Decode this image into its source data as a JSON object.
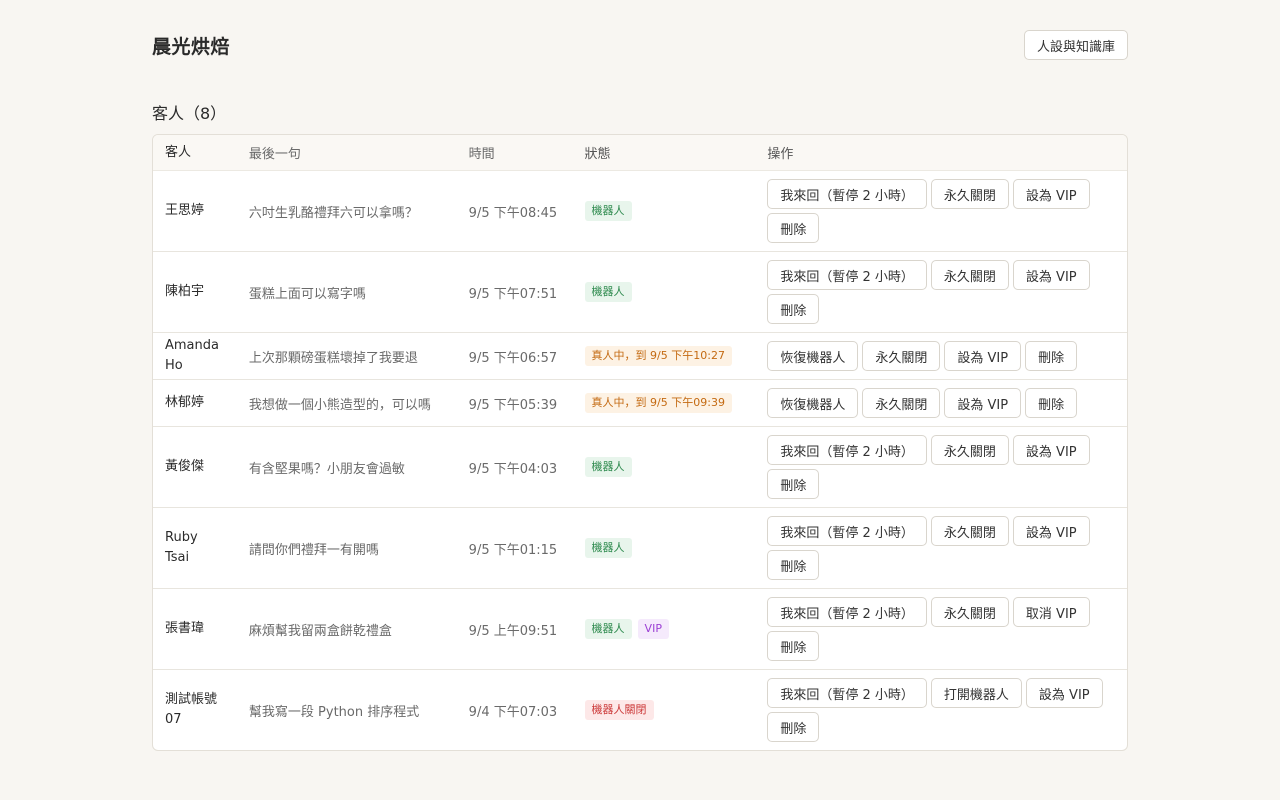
{
  "header": {
    "brand": "晨光烘焙",
    "kb_button": "人設與知識庫"
  },
  "section": {
    "title": "客人（8）"
  },
  "table": {
    "columns": [
      "客人",
      "最後一句",
      "時間",
      "狀態",
      "操作"
    ],
    "rows": [
      {
        "name": "王思婷",
        "message": "六吋生乳酪禮拜六可以拿嗎？",
        "time": "9/5 下午08:45",
        "badges": [
          {
            "text": "機器人",
            "kind": "bot"
          }
        ],
        "actions": [
          "我來回（暫停 2 小時）",
          "永久關閉",
          "設為 VIP",
          "刪除"
        ]
      },
      {
        "name": "陳柏宇",
        "message": "蛋糕上面可以寫字嗎",
        "time": "9/5 下午07:51",
        "badges": [
          {
            "text": "機器人",
            "kind": "bot"
          }
        ],
        "actions": [
          "我來回（暫停 2 小時）",
          "永久關閉",
          "設為 VIP",
          "刪除"
        ]
      },
      {
        "name": "Amanda Ho",
        "message": "上次那顆磅蛋糕壞掉了我要退",
        "time": "9/5 下午06:57",
        "badges": [
          {
            "text": "真人中，到 9/5 下午10:27",
            "kind": "human"
          }
        ],
        "actions": [
          "恢復機器人",
          "永久關閉",
          "設為 VIP",
          "刪除"
        ]
      },
      {
        "name": "林郁婷",
        "message": "我想做一個小熊造型的，可以嗎",
        "time": "9/5 下午05:39",
        "badges": [
          {
            "text": "真人中，到 9/5 下午09:39",
            "kind": "human"
          }
        ],
        "actions": [
          "恢復機器人",
          "永久關閉",
          "設為 VIP",
          "刪除"
        ]
      },
      {
        "name": "黃俊傑",
        "message": "有含堅果嗎？小朋友會過敏",
        "time": "9/5 下午04:03",
        "badges": [
          {
            "text": "機器人",
            "kind": "bot"
          }
        ],
        "actions": [
          "我來回（暫停 2 小時）",
          "永久關閉",
          "設為 VIP",
          "刪除"
        ]
      },
      {
        "name": "Ruby Tsai",
        "message": "請問你們禮拜一有開嗎",
        "time": "9/5 下午01:15",
        "badges": [
          {
            "text": "機器人",
            "kind": "bot"
          }
        ],
        "actions": [
          "我來回（暫停 2 小時）",
          "永久關閉",
          "設為 VIP",
          "刪除"
        ]
      },
      {
        "name": "張書瑋",
        "message": "麻煩幫我留兩盒餅乾禮盒",
        "time": "9/5 上午09:51",
        "badges": [
          {
            "text": "機器人",
            "kind": "bot"
          },
          {
            "text": "VIP",
            "kind": "vip"
          }
        ],
        "actions": [
          "我來回（暫停 2 小時）",
          "永久關閉",
          "取消 VIP",
          "刪除"
        ]
      },
      {
        "name": "測試帳號07",
        "message": "幫我寫一段 Python 排序程式",
        "time": "9/4 下午07:03",
        "badges": [
          {
            "text": "機器人關閉",
            "kind": "off"
          }
        ],
        "actions": [
          "我來回（暫停 2 小時）",
          "打開機器人",
          "設為 VIP",
          "刪除"
        ]
      }
    ]
  }
}
